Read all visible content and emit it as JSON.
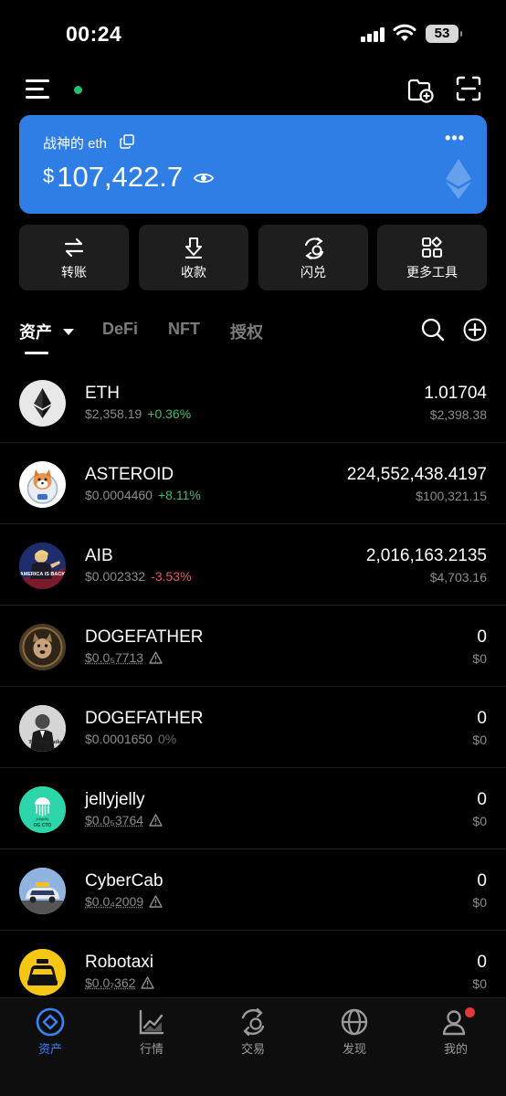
{
  "status_bar": {
    "time": "00:24",
    "battery": "53"
  },
  "wallet": {
    "name": "战神的 eth",
    "currency_symbol": "$",
    "balance": "107,422.7",
    "more": "•••"
  },
  "actions": [
    {
      "label": "转账",
      "icon": "transfer-icon"
    },
    {
      "label": "收款",
      "icon": "receive-icon"
    },
    {
      "label": "闪兑",
      "icon": "swap-icon"
    },
    {
      "label": "更多工具",
      "icon": "grid-icon"
    }
  ],
  "tabs": [
    {
      "label": "资产",
      "active": true
    },
    {
      "label": "DeFi",
      "active": false
    },
    {
      "label": "NFT",
      "active": false
    },
    {
      "label": "授权",
      "active": false
    }
  ],
  "tokens": [
    {
      "name": "ETH",
      "price": "$2,358.19",
      "change": "+0.36%",
      "change_dir": "up",
      "amount": "1.01704",
      "value": "$2,398.38",
      "warning": false
    },
    {
      "name": "ASTEROID",
      "price": "$0.0004460",
      "change": "+8.11%",
      "change_dir": "up",
      "amount": "224,552,438.4197",
      "value": "$100,321.15",
      "warning": false
    },
    {
      "name": "AIB",
      "price": "$0.002332",
      "change": "-3.53%",
      "change_dir": "down",
      "amount": "2,016,163.2135",
      "value": "$4,703.16",
      "warning": false
    },
    {
      "name": "DOGEFATHER",
      "price": "$0.0₅7713",
      "change": "",
      "change_dir": "flat",
      "amount": "0",
      "value": "$0",
      "warning": true
    },
    {
      "name": "DOGEFATHER",
      "price": "$0.0001650",
      "change": "0%",
      "change_dir": "flat",
      "amount": "0",
      "value": "$0",
      "warning": false
    },
    {
      "name": "jellyjelly",
      "price": "$0.0₅3764",
      "change": "",
      "change_dir": "flat",
      "amount": "0",
      "value": "$0",
      "warning": true
    },
    {
      "name": "CyberCab",
      "price": "$0.0₄2009",
      "change": "",
      "change_dir": "flat",
      "amount": "0",
      "value": "$0",
      "warning": true
    },
    {
      "name": "Robotaxi",
      "price": "$0.0₇362",
      "change": "",
      "change_dir": "flat",
      "amount": "0",
      "value": "$0",
      "warning": true
    }
  ],
  "avatar_texts": {
    "aib": "AMERICA IS BACK",
    "dogefather": "The Dogefather",
    "jelly_top": "jellyjelly",
    "jelly_bottom": "OG CTO"
  },
  "bottom_nav": [
    {
      "label": "资产",
      "active": true
    },
    {
      "label": "行情",
      "active": false
    },
    {
      "label": "交易",
      "active": false
    },
    {
      "label": "发现",
      "active": false
    },
    {
      "label": "我的",
      "active": false
    }
  ],
  "colors": {
    "accent": "#2f7ee6",
    "up": "#3ebd6e",
    "down": "#e45b5b",
    "active_nav": "#3b82f6"
  }
}
